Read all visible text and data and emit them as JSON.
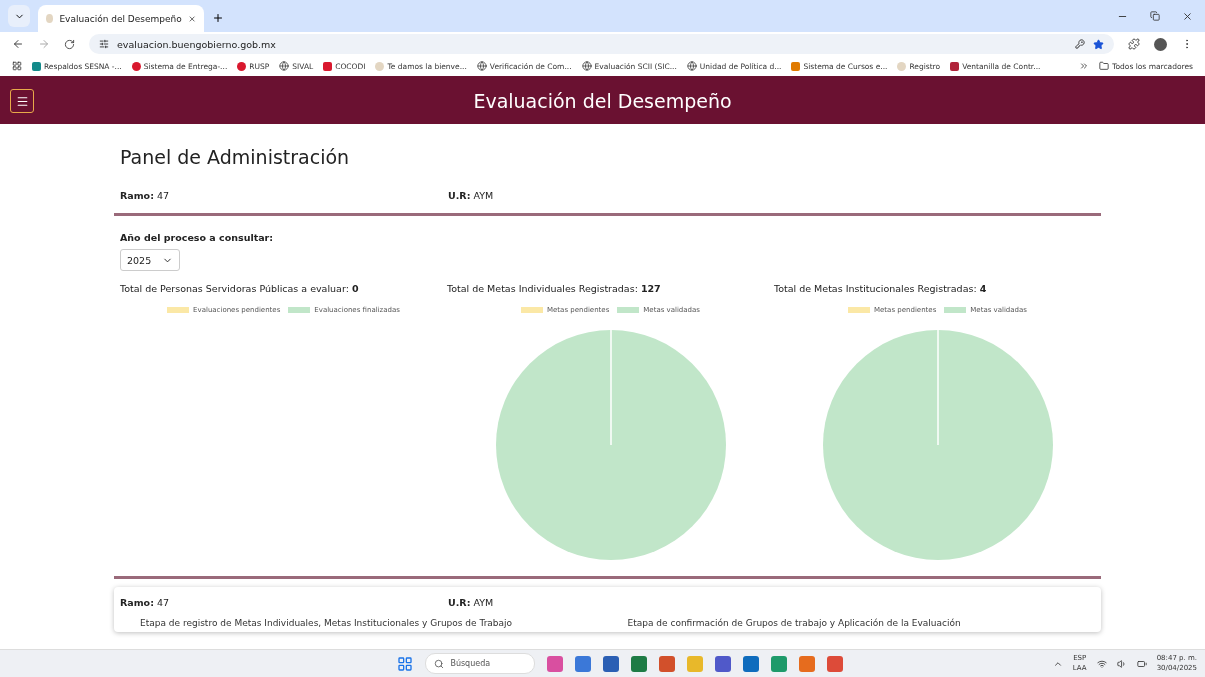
{
  "browser": {
    "tab_title": "Evaluación del Desempeño",
    "url": "evaluacion.buengobierno.gob.mx",
    "bookmarks": [
      {
        "label": "Respaldos SESNA -...",
        "kind": "badge",
        "color": "#138a8a"
      },
      {
        "label": "Sistema de Entrega-...",
        "kind": "dot",
        "color": "#d9182e"
      },
      {
        "label": "RUSP",
        "kind": "dot",
        "color": "#d9182e"
      },
      {
        "label": "SIVAL",
        "kind": "globe"
      },
      {
        "label": "COCODI",
        "kind": "flag",
        "color": "#d9182e"
      },
      {
        "label": "Te damos la bienve...",
        "kind": "dot",
        "color": "#e3d6c2"
      },
      {
        "label": "Verificación de Com...",
        "kind": "globe"
      },
      {
        "label": "Evaluación SCII (SIC...",
        "kind": "globe"
      },
      {
        "label": "Unidad de Política d...",
        "kind": "globe"
      },
      {
        "label": "Sistema de Cursos e...",
        "kind": "flag",
        "color": "#e07a00"
      },
      {
        "label": "Registro",
        "kind": "dot",
        "color": "#e3d6c2"
      },
      {
        "label": "Ventanilla de Contr...",
        "kind": "badge",
        "color": "#b0233a"
      }
    ],
    "all_bookmarks": "Todos los marcadores"
  },
  "header": {
    "title": "Evaluación del Desempeño"
  },
  "panel": {
    "title": "Panel de Administración",
    "ramo_label": "Ramo:",
    "ramo_value": "47",
    "ur_label": "U.R:",
    "ur_value": "AYM",
    "year_label": "Año del proceso a consultar:",
    "year_value": "2025"
  },
  "charts": [
    {
      "label": "Total de Personas Servidoras Públicas a evaluar:",
      "value": "0",
      "kind": "empty",
      "legend": [
        {
          "label": "Evaluaciones pendientes",
          "color": "#fbe8a6"
        },
        {
          "label": "Evaluaciones finalizadas",
          "color": "#c1e6c9"
        }
      ]
    },
    {
      "label": "Total de Metas Individuales Registradas:",
      "value": "127",
      "kind": "pie",
      "legend": [
        {
          "label": "Metas pendientes",
          "color": "#fbe8a6"
        },
        {
          "label": "Metas validadas",
          "color": "#c1e6c9"
        }
      ]
    },
    {
      "label": "Total de Metas Institucionales Registradas:",
      "value": "4",
      "kind": "pie",
      "legend": [
        {
          "label": "Metas pendientes",
          "color": "#fbe8a6"
        },
        {
          "label": "Metas validadas",
          "color": "#c1e6c9"
        }
      ]
    }
  ],
  "card": {
    "ramo_label": "Ramo:",
    "ramo_value": "47",
    "ur_label": "U.R:",
    "ur_value": "AYM",
    "stages": [
      "Etapa de registro de Metas Individuales, Metas Institucionales y Grupos de Trabajo",
      "Etapa de confirmación de Grupos de trabajo y Aplicación de la Evaluación"
    ]
  },
  "taskbar": {
    "search_placeholder": "Búsqueda",
    "lang": "ESP",
    "layout": "LAA",
    "time": "08:47 p. m.",
    "date": "30/04/2025"
  }
}
